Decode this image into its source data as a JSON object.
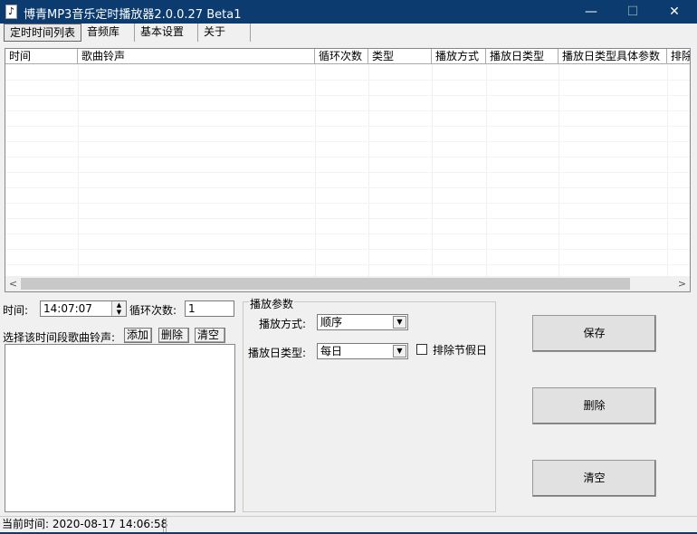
{
  "window": {
    "title": "博青MP3音乐定时播放器2.0.0.27 Beta1",
    "minimize": "—",
    "maximize": "☐",
    "close": "✕"
  },
  "tabs": [
    {
      "label": "定时时间列表",
      "selected": true
    },
    {
      "label": "音频库"
    },
    {
      "label": "基本设置"
    },
    {
      "label": "关于"
    }
  ],
  "table": {
    "columns": [
      "时间",
      "歌曲铃声",
      "循环次数",
      "类型",
      "播放方式",
      "播放日类型",
      "播放日类型具体参数",
      "排除"
    ],
    "rows": []
  },
  "form": {
    "time_label": "时间:",
    "time_value": "14:07:07",
    "loop_label": "循环次数:",
    "loop_value": "1",
    "songs_label": "选择该时间段歌曲铃声:",
    "add": "添加",
    "delete": "删除",
    "clear": "清空"
  },
  "params": {
    "title": "播放参数",
    "mode_label": "播放方式:",
    "mode_value": "顺序",
    "day_label": "播放日类型:",
    "day_value": "每日",
    "exclude_holiday_label": "排除节假日",
    "exclude_holiday_checked": false
  },
  "actions": {
    "save": "保存",
    "delete": "删除",
    "clear": "清空"
  },
  "status": {
    "current_time": "当前时间: 2020-08-17 14:06:58"
  }
}
